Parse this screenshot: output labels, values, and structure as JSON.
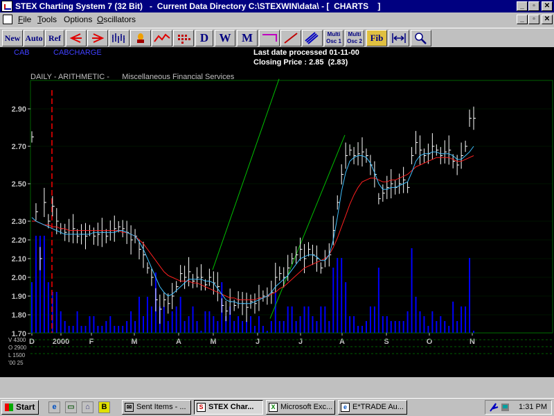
{
  "window": {
    "title": "STEX Charting System 7 (32 Bit)   -  Current Data Directory C:\\STEXWIN\\data\\ - [  CHARTS    ]",
    "controls": {
      "minimize": "_",
      "restore": "▫",
      "close": "✕"
    }
  },
  "menu": {
    "items": [
      {
        "key": "F",
        "rest": "ile"
      },
      {
        "key": "T",
        "rest": "ools"
      },
      {
        "key": "",
        "rest": "Options"
      },
      {
        "key": "O",
        "rest": "scillators"
      }
    ],
    "controls": {
      "minimize": "_",
      "restore": "▫",
      "close": "✕"
    }
  },
  "toolbar": {
    "new": "New",
    "auto": "Auto",
    "ref": "Ref",
    "d": "D",
    "w": "W",
    "m": "M",
    "multi1": [
      "Multi",
      "Osc 1"
    ],
    "multi2": [
      "Multi",
      "Osc 2"
    ],
    "fib": "Fib"
  },
  "chart": {
    "symbol": "CAB",
    "symbol_name": "CABCHARGE",
    "last_date": "Last date processed 01-11-00",
    "closing_price": "Closing Price : 2.85  (2.83)",
    "subtitle": "DAILY - ARITHMETIC -      Miscellaneous Financial Services",
    "colors": {
      "bars": "#ffffff",
      "short_ma": "#40c0ff",
      "long_ma": "#ff2020",
      "channel": "#00c000",
      "volume": "#0000ff",
      "grid": "#006000",
      "marker": "#ff0000",
      "labels": "#c0c0c0",
      "header": "#ffffff",
      "symbol": "#4040ff"
    }
  },
  "chart_data": {
    "type": "bar",
    "scale": "arithmetic",
    "ylim": [
      1.75,
      2.97
    ],
    "yticks": [
      "2.90",
      "2.70",
      "2.50",
      "2.30",
      "2.20",
      "2.10",
      "2.00",
      "1.90",
      "1.80",
      "1.70"
    ],
    "ytick_values": [
      2.9,
      2.7,
      2.5,
      2.3,
      2.2,
      2.1,
      2.0,
      1.9,
      1.8,
      1.7
    ],
    "xticks": [
      "D",
      "2000",
      "F",
      "M",
      "A",
      "M",
      "J",
      "J",
      "A",
      "S",
      "O",
      "N"
    ],
    "volume_labels": [
      "V  4300",
      "O  2900",
      "L  1500",
      "'00  25"
    ],
    "close": [
      2.75,
      2.35,
      2.1,
      2.4,
      2.3,
      2.38,
      2.3,
      2.26,
      2.24,
      2.25,
      2.26,
      2.22,
      2.23,
      2.22,
      2.25,
      2.22,
      2.23,
      2.24,
      2.22,
      2.25,
      2.26,
      2.27,
      2.26,
      2.24,
      2.2,
      2.22,
      2.15,
      2.12,
      2.05,
      2.0,
      1.88,
      1.83,
      1.88,
      1.86,
      1.9,
      1.95,
      2.02,
      2.0,
      2.03,
      1.98,
      2.0,
      2.0,
      1.96,
      2.0,
      1.97,
      1.95,
      1.85,
      1.82,
      1.87,
      1.85,
      1.88,
      1.86,
      1.84,
      1.87,
      1.86,
      1.89,
      1.9,
      1.9,
      1.92,
      2.0,
      2.02,
      2.0,
      2.05,
      2.1,
      2.12,
      2.15,
      2.1,
      2.15,
      2.12,
      2.1,
      2.05,
      2.1,
      2.12,
      2.25,
      2.4,
      2.55,
      2.65,
      2.68,
      2.65,
      2.66,
      2.67,
      2.65,
      2.6,
      2.55,
      2.42,
      2.45,
      2.48,
      2.5,
      2.48,
      2.5,
      2.52,
      2.48,
      2.65,
      2.72,
      2.68,
      2.65,
      2.66,
      2.7,
      2.68,
      2.65,
      2.67,
      2.68,
      2.62,
      2.6,
      2.65,
      2.7,
      2.85,
      2.85
    ],
    "short_ma": [
      2.32,
      2.3,
      2.29,
      2.28,
      2.27,
      2.26,
      2.25,
      2.24,
      2.23,
      2.23,
      2.23,
      2.23,
      2.23,
      2.23,
      2.23,
      2.24,
      2.24,
      2.24,
      2.24,
      2.24,
      2.24,
      2.25,
      2.25,
      2.24,
      2.23,
      2.22,
      2.19,
      2.15,
      2.1,
      2.05,
      2.0,
      1.95,
      1.92,
      1.9,
      1.91,
      1.93,
      1.95,
      1.97,
      1.99,
      1.99,
      1.99,
      1.99,
      1.98,
      1.98,
      1.97,
      1.94,
      1.91,
      1.88,
      1.87,
      1.87,
      1.86,
      1.86,
      1.86,
      1.86,
      1.87,
      1.88,
      1.89,
      1.9,
      1.92,
      1.95,
      1.97,
      1.99,
      2.01,
      2.04,
      2.07,
      2.1,
      2.11,
      2.12,
      2.12,
      2.11,
      2.09,
      2.09,
      2.12,
      2.2,
      2.32,
      2.46,
      2.56,
      2.62,
      2.64,
      2.65,
      2.65,
      2.64,
      2.61,
      2.56,
      2.5,
      2.47,
      2.47,
      2.48,
      2.48,
      2.49,
      2.5,
      2.51,
      2.56,
      2.62,
      2.65,
      2.66,
      2.66,
      2.67,
      2.67,
      2.66,
      2.66,
      2.66,
      2.65,
      2.63,
      2.63,
      2.65,
      2.67,
      2.7
    ],
    "long_ma": [
      2.3,
      2.3,
      2.29,
      2.28,
      2.28,
      2.27,
      2.27,
      2.26,
      2.26,
      2.25,
      2.25,
      2.25,
      2.25,
      2.25,
      2.25,
      2.25,
      2.25,
      2.25,
      2.25,
      2.25,
      2.25,
      2.25,
      2.24,
      2.24,
      2.23,
      2.22,
      2.2,
      2.18,
      2.15,
      2.12,
      2.09,
      2.06,
      2.03,
      2.01,
      2.0,
      1.99,
      1.98,
      1.98,
      1.98,
      1.97,
      1.97,
      1.96,
      1.95,
      1.94,
      1.93,
      1.92,
      1.91,
      1.9,
      1.89,
      1.89,
      1.88,
      1.88,
      1.88,
      1.88,
      1.88,
      1.89,
      1.89,
      1.9,
      1.91,
      1.92,
      1.94,
      1.95,
      1.97,
      1.99,
      2.01,
      2.03,
      2.05,
      2.06,
      2.07,
      2.08,
      2.09,
      2.1,
      2.12,
      2.16,
      2.21,
      2.27,
      2.33,
      2.39,
      2.44,
      2.48,
      2.51,
      2.52,
      2.53,
      2.53,
      2.52,
      2.51,
      2.51,
      2.52,
      2.52,
      2.53,
      2.54,
      2.55,
      2.57,
      2.59,
      2.6,
      2.61,
      2.62,
      2.63,
      2.64,
      2.64,
      2.64,
      2.64,
      2.63,
      2.62,
      2.62,
      2.63,
      2.64,
      2.65
    ],
    "channel_upper": [
      [
        1.97,
        2.04
      ],
      [
        2.93,
        3.06
      ]
    ],
    "channel_lower": [
      [
        2.8,
        1.78
      ],
      [
        3.88,
        2.76
      ]
    ],
    "grid": true,
    "legend": "none"
  },
  "taskbar": {
    "start": "Start",
    "quicklaunch": [
      "e",
      "▭",
      "⌂",
      "B"
    ],
    "tasks": [
      "Sent Items - ...",
      "STEX Char...",
      "Microsoft Exc...",
      "E*TRADE Au..."
    ],
    "task_icons": [
      "✉",
      "S",
      "X",
      "e"
    ],
    "clock": "1:31 PM"
  }
}
